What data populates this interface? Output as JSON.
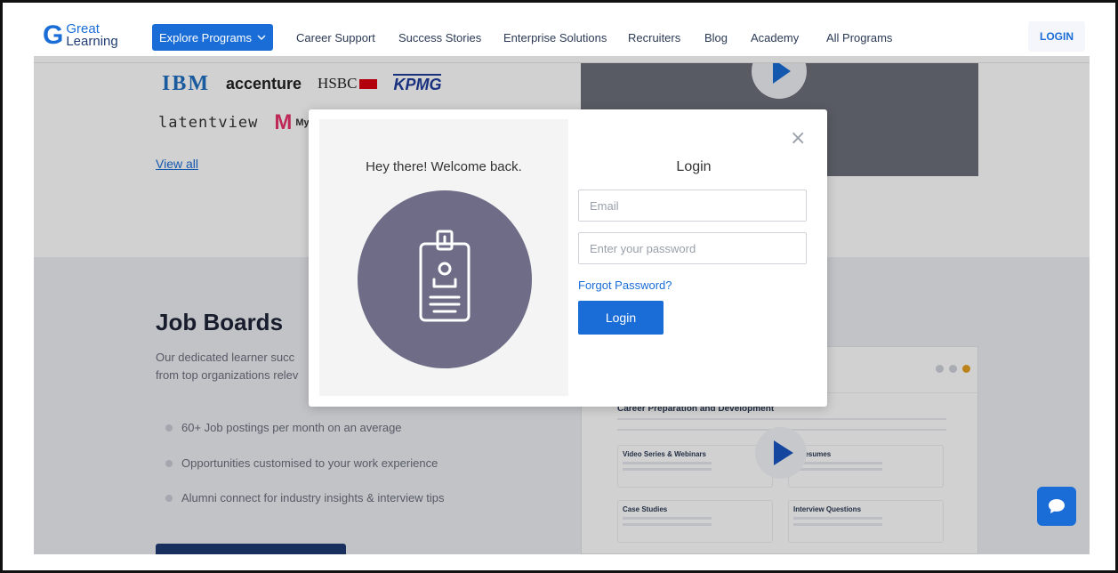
{
  "header": {
    "logo_mark": "G",
    "logo_line1": "Great",
    "logo_line2": "Learning",
    "explore_label": "Explore Programs",
    "nav": [
      {
        "label": "Career Support"
      },
      {
        "label": "Success Stories"
      },
      {
        "label": "Enterprise Solutions"
      },
      {
        "label": "Recruiters"
      },
      {
        "label": "Blog"
      },
      {
        "label": "Academy"
      },
      {
        "label": "All Programs"
      }
    ],
    "login_label": "LOGIN"
  },
  "companies": {
    "ibm": "IBM",
    "accenture": "accenture",
    "hsbc": "HSBC",
    "kpmg": "KPMG",
    "latentview": "latentview",
    "myntra": "Myntra",
    "view_all": "View all"
  },
  "job_boards": {
    "title": "Job Boards",
    "desc_line1": "Our dedicated learner succ",
    "desc_line2": "from top organizations relev",
    "bullets": [
      "60+ Job postings per month on an average",
      "Opportunities customised to your work experience",
      "Alumni connect for industry insights & interview tips"
    ]
  },
  "video_preview": {
    "heading": "Career Preparation and Development",
    "cards": [
      {
        "title": "Video Series & Webinars"
      },
      {
        "title": "e Resumes"
      },
      {
        "title": "Case Studies"
      },
      {
        "title": "Interview Questions"
      }
    ]
  },
  "modal": {
    "welcome": "Hey there! Welcome back.",
    "title": "Login",
    "close": "×",
    "email_placeholder": "Email",
    "password_placeholder": "Enter your password",
    "forgot": "Forgot Password?",
    "submit": "Login"
  },
  "colors": {
    "brand_blue": "#1a6dd6",
    "avatar_bg": "#6e6c86"
  }
}
